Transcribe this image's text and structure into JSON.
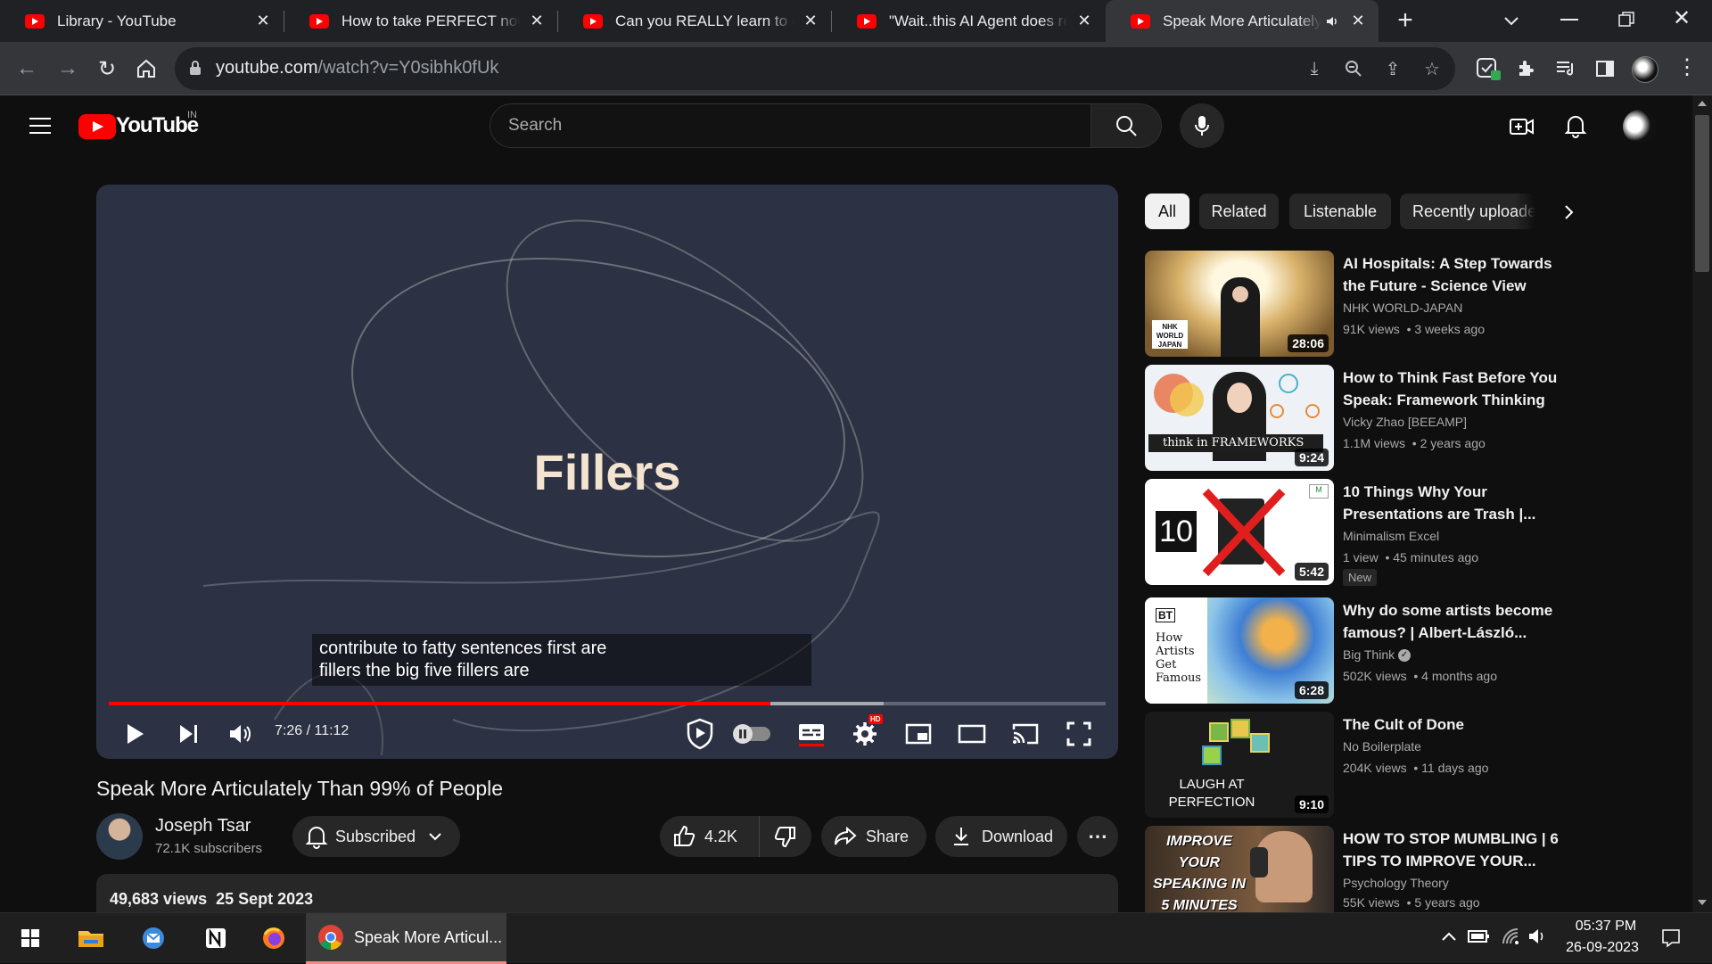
{
  "browser": {
    "tabs": [
      {
        "label": "Library - YouTube"
      },
      {
        "label": "How to take PERFECT notes w"
      },
      {
        "label": "Can you REALLY learn to code"
      },
      {
        "label": "\"Wait..this AI Agent does rese"
      },
      {
        "label": "Speak More Articulately T",
        "active": true
      }
    ],
    "url_host": "youtube.com",
    "url_path": "/watch?v=Y0sibhk0fUk"
  },
  "youtube": {
    "logo_text": "YouTube",
    "region": "IN",
    "search_placeholder": "Search"
  },
  "player": {
    "slide_title": "Fillers",
    "caption_line1": "contribute to fatty sentences first are",
    "caption_line2": "fillers the big five fillers are",
    "time_display": "7:26 / 11:12",
    "progress_fraction": 0.6637,
    "buffer_fraction": 0.777,
    "hd_badge": "HD"
  },
  "video": {
    "title": "Speak More Articulately Than 99% of People",
    "channel": "Joseph Tsar",
    "subscribers": "72.1K subscribers",
    "subscribed_label": "Subscribed",
    "likes": "4.2K",
    "share_label": "Share",
    "download_label": "Download",
    "more_label": "⋯",
    "views": "49,683 views",
    "date": "25 Sept 2023"
  },
  "chips": [
    "All",
    "Related",
    "Listenable",
    "Recently uploaded"
  ],
  "recommendations": [
    {
      "title": "AI Hospitals: A Step Towards the Future - Science View",
      "channel": "NHK WORLD-JAPAN",
      "views": "91K views",
      "age": "3 weeks ago",
      "duration": "28:06",
      "thumb_text": "NHK WORLD JAPAN"
    },
    {
      "title": "How to Think Fast Before You Speak: Framework Thinking",
      "channel": "Vicky Zhao [BEEAMP]",
      "views": "1.1M views",
      "age": "2 years ago",
      "duration": "9:24",
      "thumb_text": "think in FRAMEWORKS"
    },
    {
      "title": "10 Things Why Your Presentations are Trash |...",
      "channel": "Minimalism Excel",
      "views": "1 view",
      "age": "45 minutes ago",
      "duration": "5:42",
      "badge": "New",
      "thumb_text": "10"
    },
    {
      "title": "Why do some artists become famous? | Albert-László...",
      "channel": "Big Think",
      "views": "502K views",
      "age": "4 months ago",
      "duration": "6:28",
      "thumb_text": "How Artists Get Famous",
      "thumb_logo": "BT"
    },
    {
      "title": "The Cult of Done",
      "channel": "No Boilerplate",
      "views": "204K views",
      "age": "11 days ago",
      "duration": "9:10",
      "thumb_text": "LAUGH AT PERFECTION"
    },
    {
      "title": "HOW TO STOP MUMBLING | 6 TIPS TO IMPROVE YOUR...",
      "channel": "Psychology Theory",
      "views": "55K views",
      "age": "5 years ago",
      "duration": "",
      "thumb_text": "IMPROVE YOUR SPEAKING IN 5 MINUTES"
    }
  ],
  "taskbar": {
    "active_app_label": "Speak More Articul...",
    "time": "05:37 PM",
    "date": "26-09-2023"
  }
}
